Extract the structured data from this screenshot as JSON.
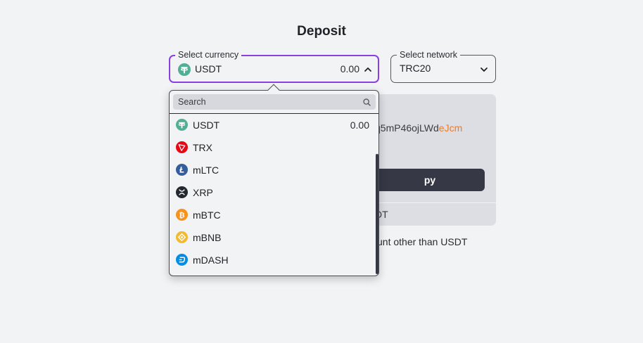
{
  "page": {
    "title": "Deposit"
  },
  "currency_select": {
    "legend": "Select currency",
    "selected_code": "USDT",
    "selected_amount": "0.00",
    "selected_icon": "usdt-icon",
    "state": "open"
  },
  "network_select": {
    "legend": "Select network",
    "value": "TRC20"
  },
  "deposit_card": {
    "address_visible": "q5mP46ojLWd",
    "address_highlight": "eJcm",
    "copy_label": "py",
    "footer_text": "DT",
    "warning_text": "unt other than USDT"
  },
  "dropdown": {
    "search_placeholder": "Search",
    "items": [
      {
        "code": "USDT",
        "amount": "0.00",
        "icon": "usdt-icon",
        "color": "#50af95"
      },
      {
        "code": "TRX",
        "amount": "",
        "icon": "trx-icon",
        "color": "#e50915"
      },
      {
        "code": "mLTC",
        "amount": "",
        "icon": "ltc-icon",
        "color": "#345d9d"
      },
      {
        "code": "XRP",
        "amount": "",
        "icon": "xrp-icon",
        "color": "#23292f"
      },
      {
        "code": "mBTC",
        "amount": "",
        "icon": "btc-icon",
        "color": "#f7931a"
      },
      {
        "code": "mBNB",
        "amount": "",
        "icon": "bnb-icon",
        "color": "#f3ba2f"
      },
      {
        "code": "mDASH",
        "amount": "",
        "icon": "dash-icon",
        "color": "#008de4"
      }
    ]
  },
  "colors": {
    "accent": "#8a3fe0",
    "background": "#f2f3f5",
    "button": "#363846",
    "address_highlight": "#f07a22"
  }
}
